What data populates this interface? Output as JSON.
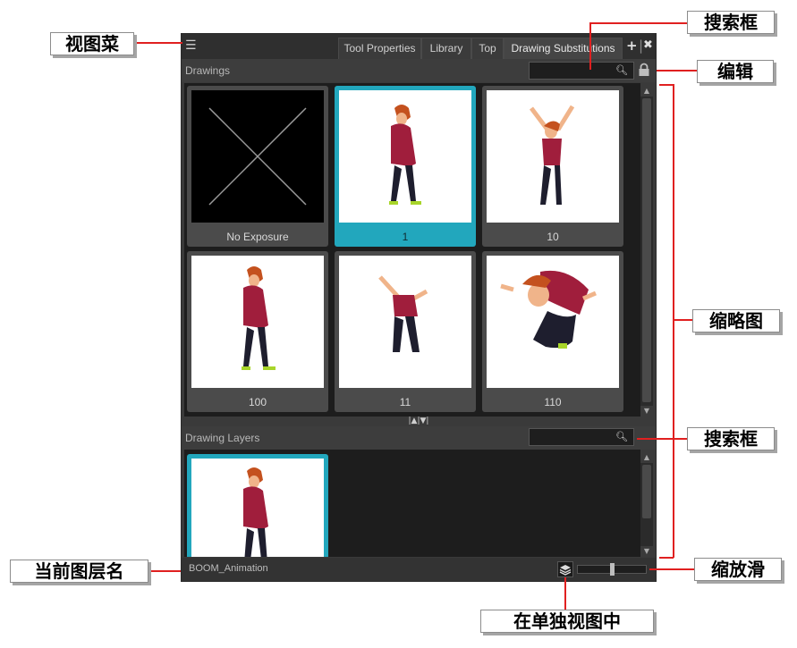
{
  "tabs": [
    "Tool Properties",
    "Library",
    "Top",
    "Drawing Substitutions"
  ],
  "active_tab": "Drawing Substitutions",
  "drawings_section": {
    "title": "Drawings",
    "thumbnails": [
      {
        "label": "No Exposure",
        "selected": false,
        "empty": true
      },
      {
        "label": "1",
        "selected": true,
        "empty": false
      },
      {
        "label": "10",
        "selected": false,
        "empty": false
      },
      {
        "label": "100",
        "selected": false,
        "empty": false
      },
      {
        "label": "11",
        "selected": false,
        "empty": false
      },
      {
        "label": "110",
        "selected": false,
        "empty": false
      }
    ]
  },
  "layers_section": {
    "title": "Drawing Layers"
  },
  "footer": {
    "layer_name": "BOOM_Animation",
    "zoom_level": 0.5
  },
  "callouts": {
    "view_menu": "视图菜",
    "search_top": "搜索框",
    "edit": "编辑",
    "thumbnails": "缩略图",
    "search_bottom": "搜索框",
    "current_layer": "当前图层名",
    "zoom_slider": "缩放滑",
    "solo_view": "在单独视图中"
  },
  "colors": {
    "accent_selected": "#22a7bd",
    "callout_line": "#e02020",
    "panel_bg": "#3a3a3a",
    "thumb_area_bg": "#1d1d1d"
  }
}
